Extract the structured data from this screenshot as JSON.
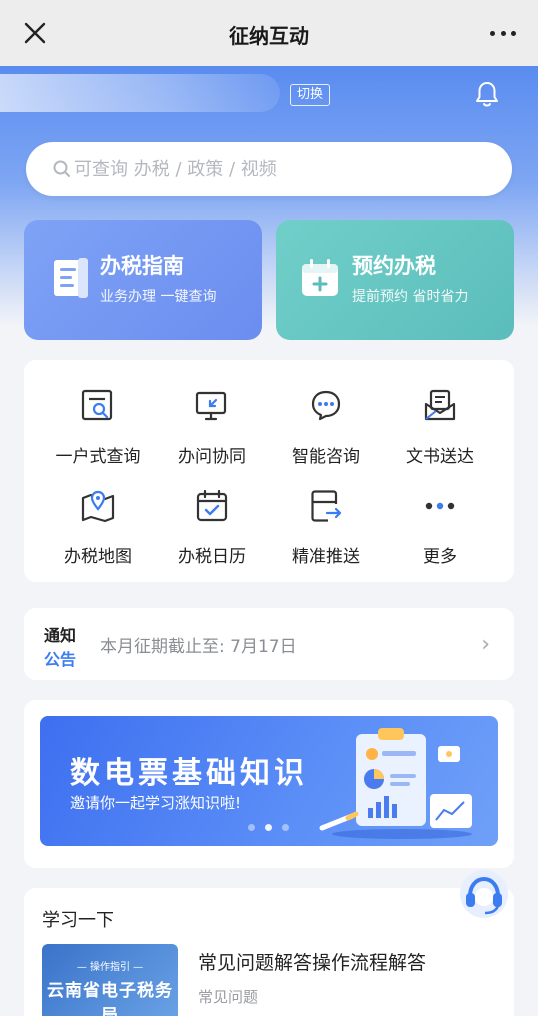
{
  "nav": {
    "title": "征纳互动"
  },
  "user": {
    "switch_label": "切换"
  },
  "search": {
    "placeholder": "可查询 办税 / 政策 / 视频"
  },
  "cards": [
    {
      "title": "办税指南",
      "subtitle": "业务办理 一键查询"
    },
    {
      "title": "预约办税",
      "subtitle": "提前预约 省时省力"
    }
  ],
  "grid": [
    {
      "label": "一户式查询",
      "icon": "document-search-icon"
    },
    {
      "label": "办问协同",
      "icon": "monitor-icon"
    },
    {
      "label": "智能咨询",
      "icon": "chat-bubble-icon"
    },
    {
      "label": "文书送达",
      "icon": "mail-document-icon"
    },
    {
      "label": "办税地图",
      "icon": "map-pin-icon"
    },
    {
      "label": "办税日历",
      "icon": "calendar-check-icon"
    },
    {
      "label": "精准推送",
      "icon": "push-card-icon"
    },
    {
      "label": "更多",
      "icon": "more-dots-icon"
    }
  ],
  "notice": {
    "tag_top": "通知",
    "tag_bottom": "公告",
    "message": "本月征期截止至: 7月17日"
  },
  "banner": {
    "title": "数电票基础知识",
    "subtitle": "邀请你一起学习涨知识啦!"
  },
  "learn": {
    "title": "学习一下",
    "item_title": "常见问题解答操作流程解答",
    "item_subtitle": "常见问题",
    "thumb_top": "— 操作指引 —",
    "thumb_main": "云南省电子税务局"
  },
  "colors": {
    "accent": "#3b7cf0",
    "guide_card": "#7ea3f5",
    "appt_card": "#5bbdbb"
  }
}
